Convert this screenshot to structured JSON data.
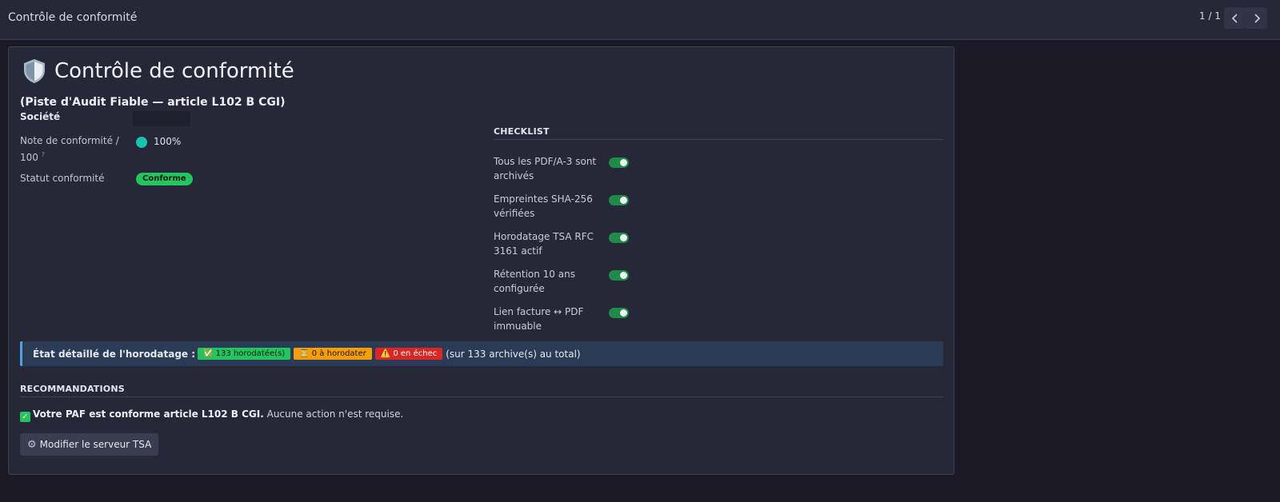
{
  "topbar": {
    "title": "Contrôle de conformité",
    "pager": "1 / 1",
    "prev_icon": "chevron-left-icon",
    "next_icon": "chevron-right-icon"
  },
  "sheet": {
    "title": "Contrôle de conformité",
    "subtitle": "(Piste d'Audit Fiable — article L102 B CGI)",
    "fields": {
      "societe_label": "Société",
      "note_label": "Note de conformité / 100",
      "note_help": "?",
      "note_value": "100%",
      "statut_label": "Statut conformité",
      "statut_value": "Conforme"
    },
    "checklist": {
      "title": "CHECKLIST",
      "items": [
        {
          "label": "Tous les PDF/A-3 sont archivés",
          "checked": true
        },
        {
          "label": "Empreintes SHA-256 vérifiées",
          "checked": true
        },
        {
          "label": "Horodatage TSA RFC 3161 actif",
          "checked": true
        },
        {
          "label": "Rétention 10 ans configurée",
          "checked": true
        },
        {
          "label": "Lien facture ↔ PDF immuable",
          "checked": true
        }
      ]
    },
    "timestamp_status": {
      "lead": "État détaillé de l'horodatage :",
      "stamped": "✅ 133 horodatée(s)",
      "pending": "⏳ 0 à horodater",
      "failed": "⚠️ 0 en échec",
      "total": "(sur 133 archive(s) au total)"
    },
    "recommendations": {
      "title": "RECOMMANDATIONS",
      "message_bold": "Votre PAF est conforme article L102 B CGI.",
      "message_rest": " Aucune action n'est requise."
    },
    "button": {
      "label": "Modifier le serveur TSA",
      "icon": "gear-icon"
    }
  },
  "colors": {
    "background": "#1b1a24",
    "panel": "#262837",
    "success": "#22c55e",
    "warning": "#f59e0b",
    "danger": "#dc2626",
    "info_border": "#4fa3e0",
    "score_dot": "#19c3b0"
  }
}
